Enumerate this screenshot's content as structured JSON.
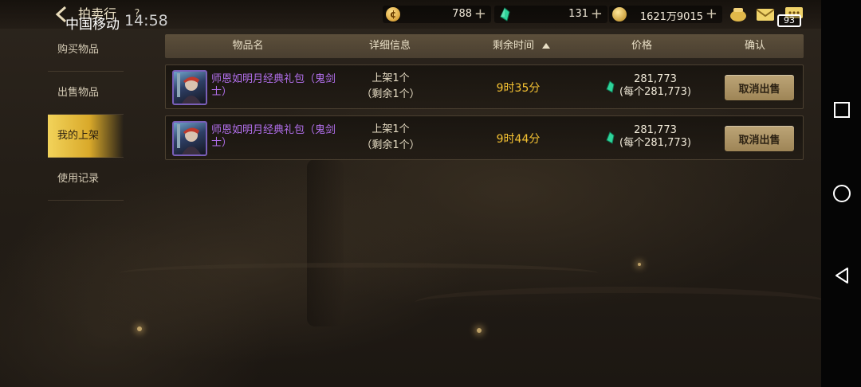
{
  "status_bar": {
    "carrier": "中国移动",
    "time": "14:58",
    "battery": "93"
  },
  "header": {
    "title": "拍卖行",
    "help_glyph": "?"
  },
  "currencies": [
    {
      "icon": "gold-c-coin-icon",
      "value": "788",
      "plus": "+"
    },
    {
      "icon": "green-gem-icon",
      "value": "131",
      "plus": "+"
    },
    {
      "icon": "gold-coin-icon",
      "value": "1621万9015",
      "plus": "+"
    }
  ],
  "top_icons": [
    "treasure-pot-icon",
    "mail-icon",
    "chat-icon"
  ],
  "sidebar": {
    "items": [
      {
        "label": "购买物品",
        "active": false
      },
      {
        "label": "出售物品",
        "active": false
      },
      {
        "label": "我的上架",
        "active": true
      },
      {
        "label": "使用记录",
        "active": false
      }
    ]
  },
  "table": {
    "headers": {
      "name": "物品名",
      "detail": "详细信息",
      "time": "剩余时间",
      "price": "价格",
      "confirm": "确认"
    },
    "sort": "time-ascending",
    "rows": [
      {
        "name": "师恩如明月经典礼包（鬼剑士）",
        "detail_line1": "上架1个",
        "detail_line2": "（剩余1个）",
        "time": "9时35分",
        "price": "281,773",
        "unit_price": "(每个281,773)",
        "action": "取消出售"
      },
      {
        "name": "师恩如明月经典礼包（鬼剑士）",
        "detail_line1": "上架1个",
        "detail_line2": "（剩余1个）",
        "time": "9时44分",
        "price": "281,773",
        "unit_price": "(每个281,773)",
        "action": "取消出售"
      }
    ]
  },
  "colors": {
    "accent_gold": "#f6c333",
    "item_purple": "#b470ef",
    "button": "#b09a6b",
    "sidebar_active": "#e8c040"
  },
  "android_nav": [
    "recent-apps-icon",
    "home-icon",
    "back-nav-icon"
  ]
}
